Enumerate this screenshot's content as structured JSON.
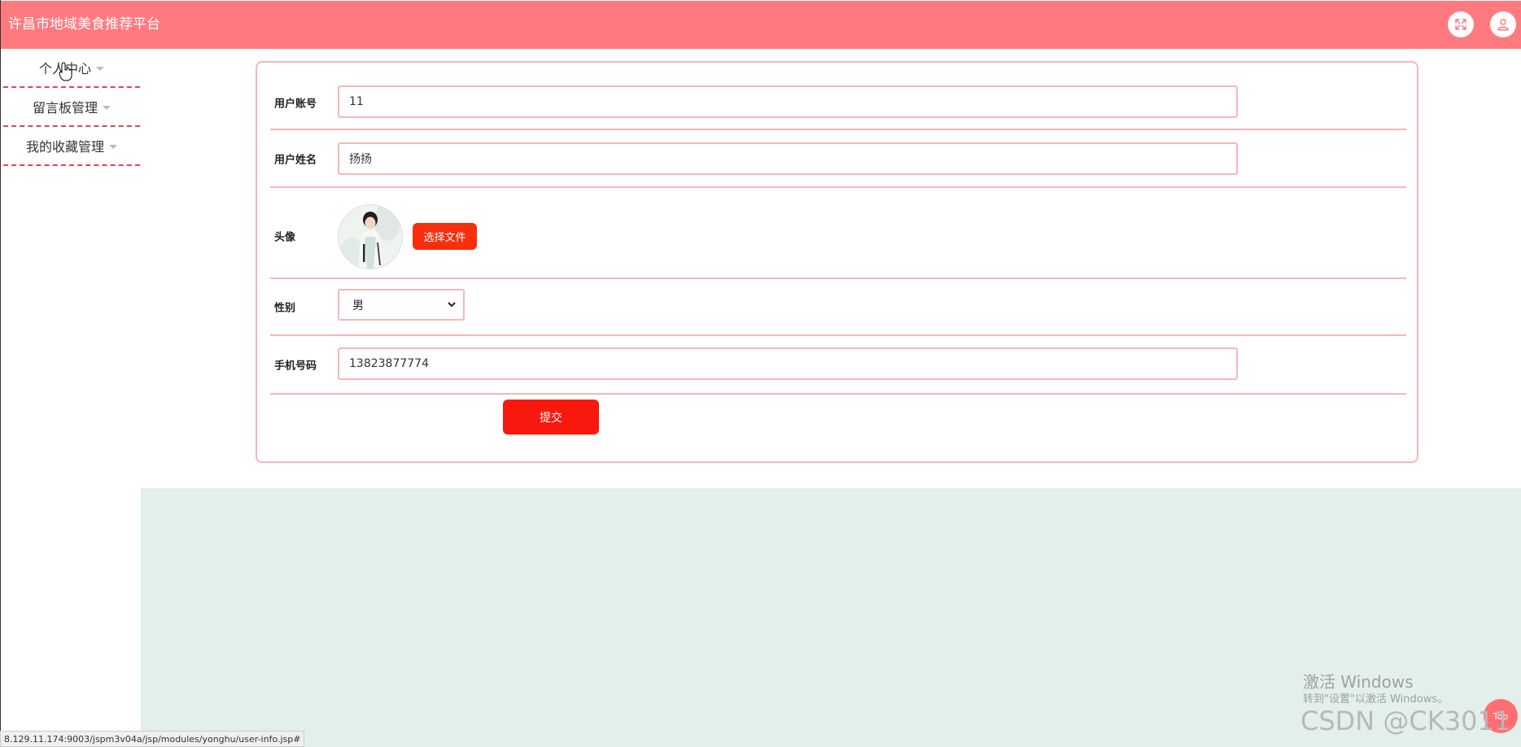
{
  "header": {
    "title": "许昌市地域美食推荐平台",
    "icons": [
      "fullscreen-icon",
      "user-icon"
    ],
    "bg_color": "#ff7a7f"
  },
  "sidebar": {
    "items": [
      {
        "label": "个人中心"
      },
      {
        "label": "留言板管理"
      },
      {
        "label": "我的收藏管理"
      }
    ]
  },
  "form": {
    "account": {
      "label": "用户账号",
      "value": "11"
    },
    "name": {
      "label": "用户姓名",
      "value": "扬扬"
    },
    "avatar": {
      "label": "头像",
      "button_label": "选择文件"
    },
    "gender": {
      "label": "性别",
      "value": "男"
    },
    "phone": {
      "label": "手机号码",
      "value": "13823877774"
    },
    "submit_label": "提交"
  },
  "status_bar": {
    "url": "8.129.11.174:9003/jspm3v04a/jsp/modules/yonghu/user-info.jsp#"
  },
  "overlays": {
    "windows_title": "激活 Windows",
    "windows_sub": "转到\"设置\"以激活 Windows。",
    "csdn": "CSDN @CK3011",
    "back_top": "Top"
  },
  "colors": {
    "accent": "#f82e0c",
    "border": "#f6b7b7",
    "panel_bg": "#e3efeb"
  }
}
